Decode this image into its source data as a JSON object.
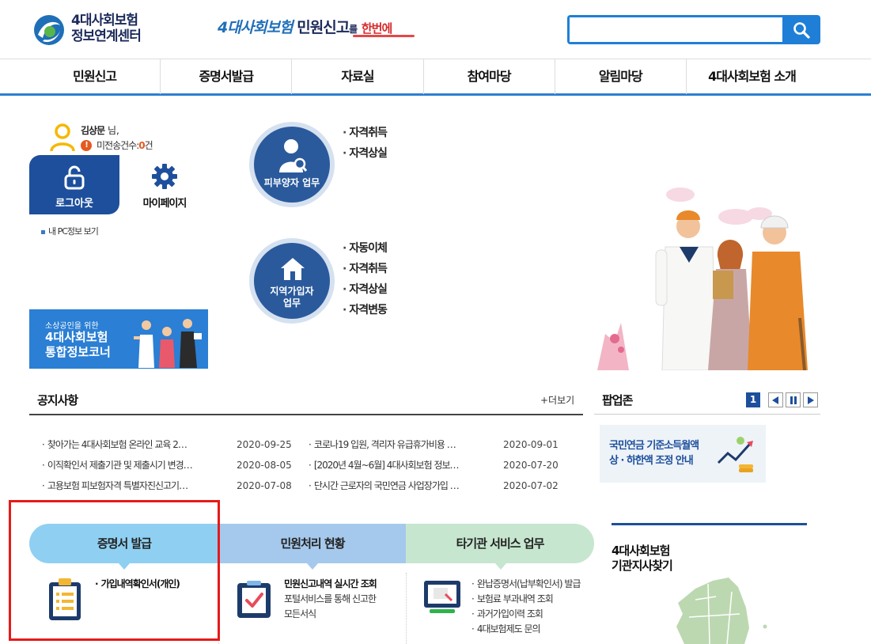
{
  "header": {
    "logo_line1": "4대사회보험",
    "logo_line2": "정보연계센터",
    "slogan_part1": "4대사회보험",
    "slogan_part2": "민원신고",
    "slogan_part3": "를",
    "slogan_part4": "한번에",
    "search_value": "",
    "search_icon": "search-icon"
  },
  "nav": [
    "민원신고",
    "증명서발급",
    "자료실",
    "참여마당",
    "알림마당",
    "4대사회보험 소개"
  ],
  "user": {
    "name": "김상문",
    "honorific": "님,",
    "unsent_label": "미전송건수:",
    "unsent_count": "0",
    "unsent_unit": "건",
    "logout_label": "로그아웃",
    "mypage_label": "마이페이지",
    "pcinfo_label": "내 PC정보 보기"
  },
  "services": {
    "dependent": {
      "label": "피부양자 업무",
      "items": [
        "자격취득",
        "자격상실"
      ]
    },
    "regional": {
      "label_line1": "지역가입자",
      "label_line2": "업무",
      "items": [
        "자동이체",
        "자격취득",
        "자격상실",
        "자격변동"
      ]
    }
  },
  "banner": {
    "line1": "소상공인을 위한",
    "line2": "4대사회보험",
    "line3": "통합정보코너"
  },
  "notice": {
    "title": "공지사항",
    "more": "+더보기",
    "items": [
      {
        "title": "찾아가는 4대사회보험 온라인 교육 2…",
        "date": "2020-09-25"
      },
      {
        "title": "코로나19 입원, 격리자 유급휴가비용 …",
        "date": "2020-09-01"
      },
      {
        "title": "이직확인서 제출기관 및 제출시기 변경…",
        "date": "2020-08-05"
      },
      {
        "title": "[2020년 4월~6월] 4대사회보험 정보…",
        "date": "2020-07-20"
      },
      {
        "title": "고용보험 피보험자격 특별자진신고기…",
        "date": "2020-07-08"
      },
      {
        "title": "단시간 근로자의 국민연금 사업장가입 …",
        "date": "2020-07-02"
      }
    ]
  },
  "popupzone": {
    "title": "팝업존",
    "page": "1",
    "card_line1": "국민연금 기준소득월액",
    "card_line2": "상 · 하한액 조정 안내"
  },
  "tabs": {
    "cert": {
      "label": "증명서 발급",
      "item": "가입내역확인서(개인)"
    },
    "status": {
      "label": "민원처리 현황",
      "head": "민원신고내역 실시간 조회",
      "desc_line1": "포털서비스를 통해 신고한",
      "desc_line2": "모든서식"
    },
    "other": {
      "label": "타기관 서비스 업무",
      "items": [
        "완납증명서(납부확인서) 발급",
        "보험료 부과내역 조회",
        "과거가입이력 조회",
        "4대보험제도 문의"
      ]
    }
  },
  "branch": {
    "line1": "4대사회보험",
    "line2": "기관지사찾기"
  }
}
